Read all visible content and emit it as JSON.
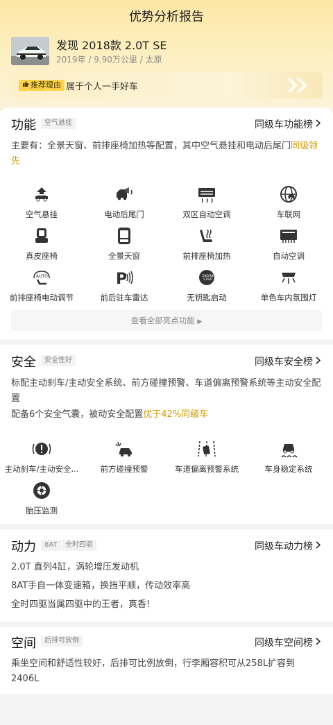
{
  "page": {
    "title": "优势分析报告"
  },
  "car": {
    "name": "发现 2018款 2.0T SE",
    "meta": "2019年 / 9.90万公里 / 太原",
    "reason_badge": "推荐理由",
    "reason_text": "属于个人一手好车"
  },
  "function": {
    "title": "功能",
    "tag": "空气悬挂",
    "rank_link": "同级车功能榜",
    "desc_main": "主要有：全景天窗、前排座椅加热等配置，其中空气悬挂和电动后尾门",
    "desc_highlight": "同级领先",
    "features": [
      {
        "label": "空气悬挂",
        "icon": "air-suspension-icon"
      },
      {
        "label": "电动后尾门",
        "icon": "power-tailgate-icon"
      },
      {
        "label": "双区自动空调",
        "icon": "dual-zone-ac-icon"
      },
      {
        "label": "车联网",
        "icon": "connected-car-icon"
      },
      {
        "label": "真皮座椅",
        "icon": "leather-seat-icon"
      },
      {
        "label": "全景天窗",
        "icon": "panoramic-sunroof-icon"
      },
      {
        "label": "前排座椅加热",
        "icon": "seat-heating-icon"
      },
      {
        "label": "自动空调",
        "icon": "auto-ac-icon"
      },
      {
        "label": "前排座椅电动调节",
        "icon": "power-seat-icon"
      },
      {
        "label": "前后驻车雷达",
        "icon": "parking-radar-icon"
      },
      {
        "label": "无钥匙启动",
        "icon": "keyless-start-icon"
      },
      {
        "label": "单色车内氛围灯",
        "icon": "ambient-light-icon"
      }
    ],
    "more_button": "查看全部亮点功能"
  },
  "safety": {
    "title": "安全",
    "tag": "安全性好",
    "rank_link": "同级车安全榜",
    "desc1": "标配主动刹车/主动安全系统、前方碰撞预警、车道偏离预警系统等主动安全配置",
    "desc2_main": "配备6个安全气囊，被动安全配置",
    "desc2_highlight": "优于42%同级车",
    "features": [
      {
        "label": "主动刹车/主动安全...",
        "icon": "active-brake-icon"
      },
      {
        "label": "前方碰撞预警",
        "icon": "collision-warning-icon"
      },
      {
        "label": "车道偏离预警系统",
        "icon": "lane-departure-icon"
      },
      {
        "label": "车身稳定系统",
        "icon": "stability-control-icon"
      },
      {
        "label": "胎压监测",
        "icon": "tire-pressure-icon"
      }
    ]
  },
  "power": {
    "title": "动力",
    "tags": [
      "8AT",
      "全时四驱"
    ],
    "rank_link": "同级车动力榜",
    "lines": [
      "2.0T 直列4缸，涡轮增压发动机",
      "8AT手自一体变速箱，换挡平顺，传动效率高",
      "全时四驱当属四驱中的王者，真香!"
    ]
  },
  "space": {
    "title": "空间",
    "tag": "后排可放倒",
    "rank_link": "同级车空间榜",
    "desc": "乘坐空间和舒适性较好，后排可比例放倒，行李厢容积可从258L扩容到2406L"
  },
  "colors": {
    "accent": "#d29b00",
    "badge": "#fbd24c",
    "hero": "#fde7a6"
  }
}
